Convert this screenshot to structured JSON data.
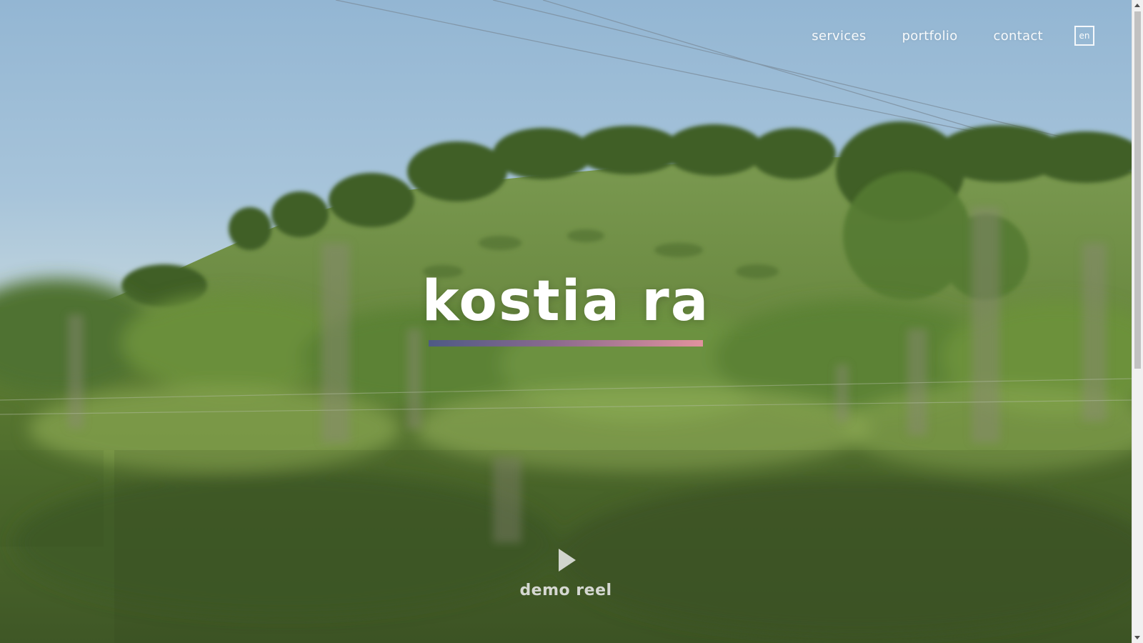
{
  "nav": {
    "items": [
      {
        "label": "services"
      },
      {
        "label": "portfolio"
      },
      {
        "label": "contact"
      }
    ],
    "language": "en"
  },
  "hero": {
    "title": "kostia ra",
    "underline_gradient": [
      "#4e5a85",
      "#8a6a8e",
      "#e1929e"
    ]
  },
  "demo": {
    "icon": "play-icon",
    "label": "demo reel"
  },
  "colors": {
    "sky": "#9dbdd6",
    "grass": "#6f8a3f",
    "text": "#ffffff"
  }
}
